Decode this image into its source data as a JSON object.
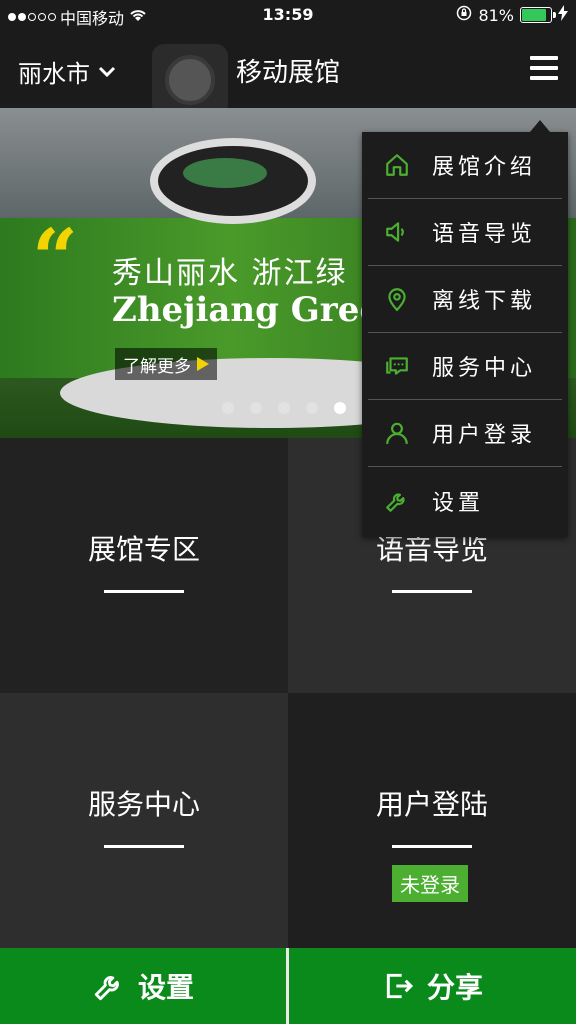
{
  "status": {
    "carrier": "中国移动",
    "time": "13:59",
    "battery": "81%"
  },
  "header": {
    "city": "丽水市",
    "title": "移动展馆"
  },
  "banner": {
    "quote_mark": "“",
    "slogan_cn": "秀山丽水  浙江绿",
    "slogan_en": "Zhejiang Green V",
    "more_label": "了解更多",
    "slide_count": 5,
    "active_slide": 5
  },
  "tiles": [
    {
      "label": "展馆专区"
    },
    {
      "label": "语音导览"
    },
    {
      "label": "服务中心"
    },
    {
      "label": "用户登陆",
      "badge": "未登录"
    }
  ],
  "bottom": {
    "settings_label": "设置",
    "share_label": "分享"
  },
  "menu": {
    "items": [
      {
        "label": "展馆介绍",
        "icon": "home-icon"
      },
      {
        "label": "语音导览",
        "icon": "speaker-icon"
      },
      {
        "label": "离线下载",
        "icon": "location-pin-icon"
      },
      {
        "label": "服务中心",
        "icon": "chat-icon"
      },
      {
        "label": "用户登录",
        "icon": "user-icon"
      },
      {
        "label": "设置",
        "icon": "wrench-icon"
      }
    ]
  },
  "colors": {
    "accent": "#4caf31",
    "bottom_bar": "#0a8a1a",
    "quote": "#f2d400"
  }
}
